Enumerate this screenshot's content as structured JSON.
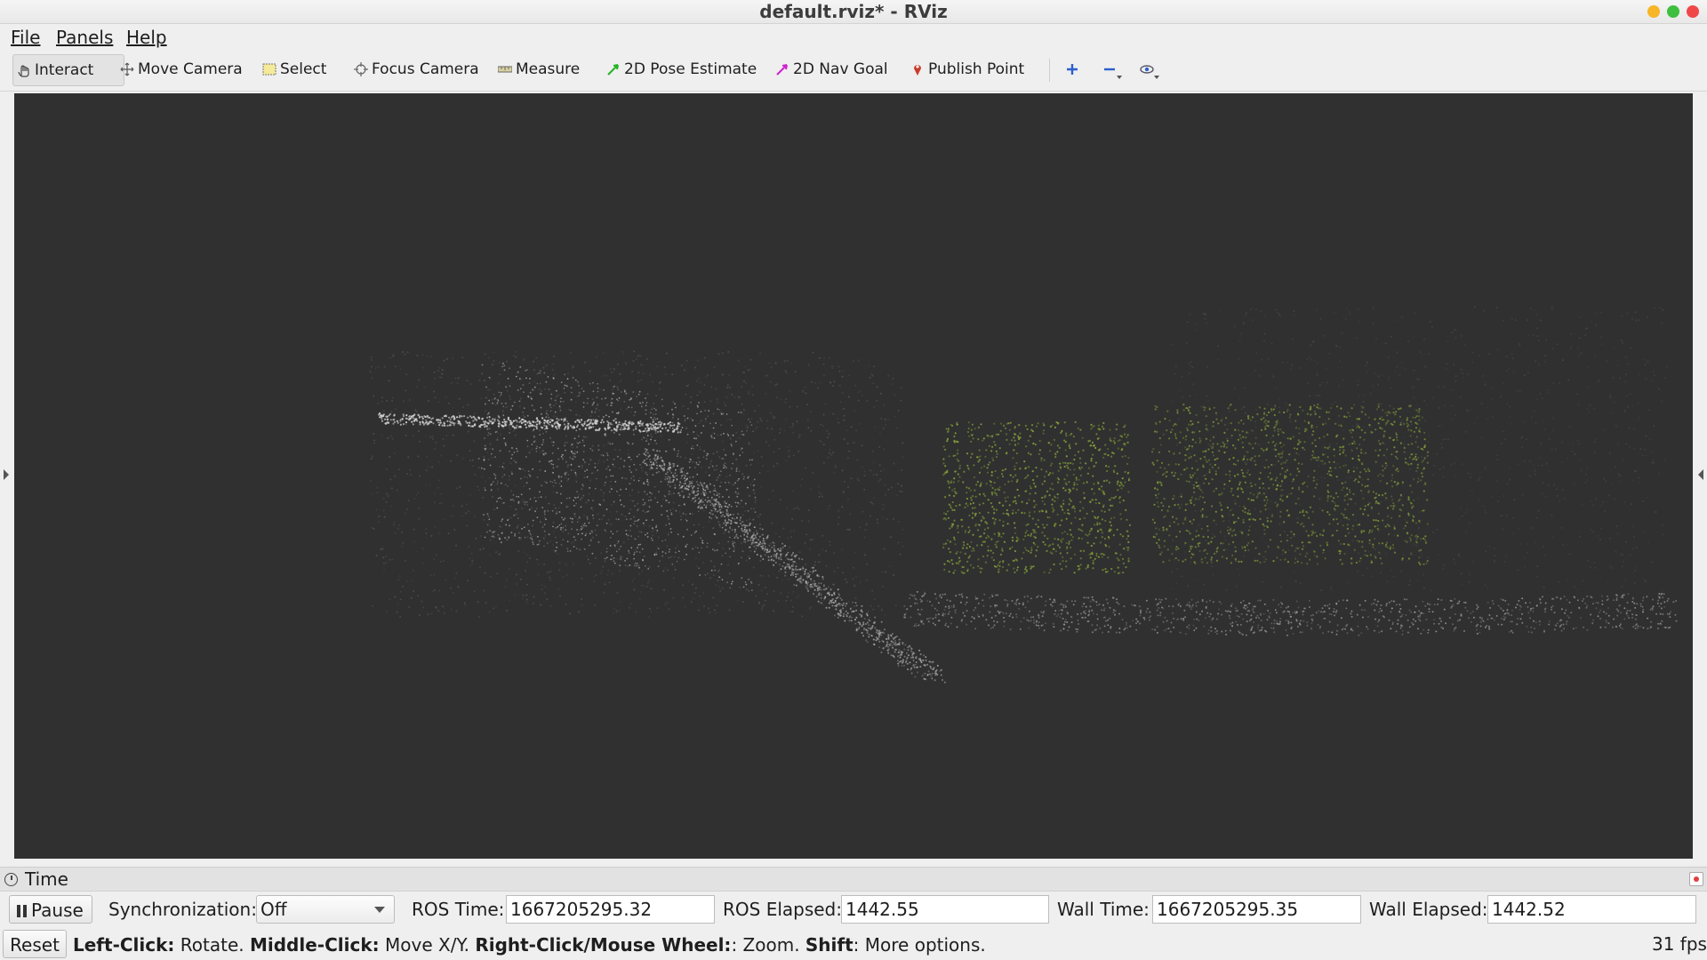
{
  "window": {
    "title": "default.rviz* - RViz"
  },
  "menu": [
    {
      "key": "file",
      "label": "File"
    },
    {
      "key": "panels",
      "label": "Panels"
    },
    {
      "key": "help",
      "label": "Help"
    }
  ],
  "toolbar": {
    "interact": "Interact",
    "move_camera": "Move Camera",
    "select": "Select",
    "focus_camera": "Focus Camera",
    "measure": "Measure",
    "pose_estimate": "2D Pose Estimate",
    "nav_goal": "2D Nav Goal",
    "publish_point": "Publish Point",
    "icons": {
      "add": "plus-icon",
      "remove": "minus-icon",
      "view": "eye-icon"
    }
  },
  "time_panel": {
    "title": "Time",
    "pause_label": "Pause",
    "sync_label": "Synchronization:",
    "sync_value": "Off",
    "ros_time_label": "ROS Time:",
    "ros_time_value": "1667205295.32",
    "ros_elapsed_label": "ROS Elapsed:",
    "ros_elapsed_value": "1442.55",
    "wall_time_label": "Wall Time:",
    "wall_time_value": "1667205295.35",
    "wall_elapsed_label": "Wall Elapsed:",
    "wall_elapsed_value": "1442.52"
  },
  "status": {
    "reset_label": "Reset",
    "left_click": "Left-Click:",
    "left_action": " Rotate. ",
    "middle_click": "Middle-Click:",
    "middle_action": " Move X/Y. ",
    "right_click": "Right-Click/Mouse Wheel:",
    "right_action": ": Zoom. ",
    "shift": "Shift",
    "shift_action": ": More options.",
    "fps": "31 fps"
  },
  "colors": {
    "viewport_bg": "#303030",
    "pose_estimate": "#22b422",
    "nav_goal": "#d020d0",
    "publish_point": "#c83c28",
    "point_white": "#d8d8d8",
    "point_green": "#8aa83a"
  }
}
